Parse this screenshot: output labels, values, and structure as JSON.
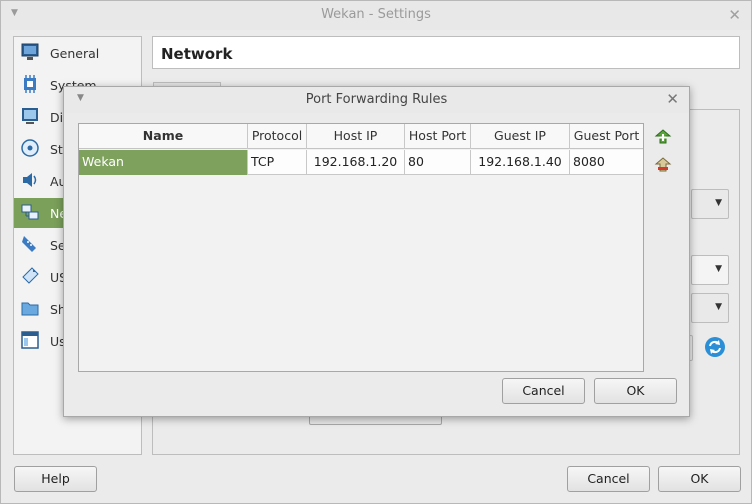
{
  "window": {
    "title": "Wekan - Settings"
  },
  "sidebar": {
    "items": [
      {
        "label": "General",
        "icon": "monitor-icon"
      },
      {
        "label": "System",
        "icon": "chip-icon"
      },
      {
        "label": "Dis",
        "icon": "display-icon"
      },
      {
        "label": "Sto",
        "icon": "storage-icon"
      },
      {
        "label": "Au",
        "icon": "audio-icon"
      },
      {
        "label": "Ne",
        "icon": "network-icon",
        "selected": true
      },
      {
        "label": "Se",
        "icon": "serial-icon"
      },
      {
        "label": "US",
        "icon": "usb-icon"
      },
      {
        "label": "Sh",
        "icon": "shared-folder-icon"
      },
      {
        "label": "Us",
        "icon": "user-interface-icon"
      }
    ]
  },
  "page": {
    "title": "Network"
  },
  "dialog": {
    "title": "Port Forwarding Rules",
    "columns": [
      "Name",
      "Protocol",
      "Host IP",
      "Host Port",
      "Guest IP",
      "Guest Port"
    ],
    "rows": [
      {
        "name": "Wekan",
        "protocol": "TCP",
        "host_ip": "192.168.1.20",
        "host_port": "80",
        "guest_ip": "192.168.1.40",
        "guest_port": "8080"
      }
    ],
    "cancel_label": "Cancel",
    "ok_label": "OK"
  },
  "footer": {
    "help_label": "Help",
    "cancel_label": "Cancel",
    "ok_label": "OK"
  },
  "colors": {
    "selection": "#7fa15e",
    "accent_icon": "#2a8fd6"
  }
}
